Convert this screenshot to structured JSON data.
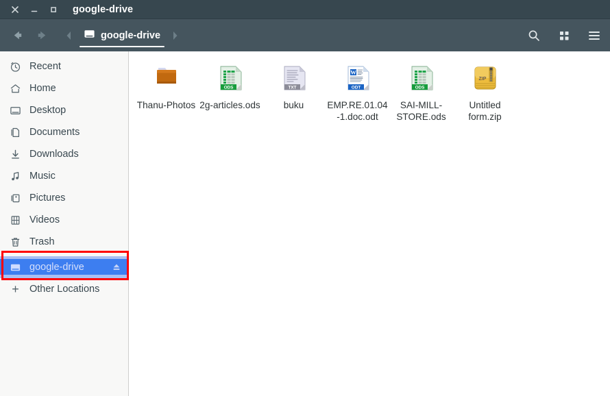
{
  "window": {
    "title": "google-drive",
    "controls": [
      {
        "name": "close",
        "glyph": "close-icon"
      },
      {
        "name": "minimize",
        "glyph": "minimize-icon"
      },
      {
        "name": "maximize",
        "glyph": "maximize-icon"
      }
    ]
  },
  "toolbar": {
    "back_label": "Back",
    "forward_label": "Forward",
    "prev_crumb_label": "",
    "next_crumb_label": "",
    "breadcrumb": {
      "label": "google-drive",
      "icon": "drive-icon"
    },
    "search_label": "Search",
    "view_grid_label": "View options",
    "menu_label": "Main menu"
  },
  "sidebar": {
    "items": [
      {
        "label": "Recent",
        "icon": "clock-icon",
        "selected": false
      },
      {
        "label": "Home",
        "icon": "home-icon",
        "selected": false
      },
      {
        "label": "Desktop",
        "icon": "desktop-icon",
        "selected": false
      },
      {
        "label": "Documents",
        "icon": "documents-icon",
        "selected": false
      },
      {
        "label": "Downloads",
        "icon": "downloads-icon",
        "selected": false
      },
      {
        "label": "Music",
        "icon": "music-icon",
        "selected": false
      },
      {
        "label": "Pictures",
        "icon": "pictures-icon",
        "selected": false
      },
      {
        "label": "Videos",
        "icon": "videos-icon",
        "selected": false
      },
      {
        "label": "Trash",
        "icon": "trash-icon",
        "selected": false
      },
      {
        "label": "google-drive",
        "icon": "drive-icon",
        "selected": true,
        "eject": true
      }
    ],
    "other_locations": {
      "label": "Other Locations",
      "icon": "plus-icon"
    }
  },
  "annotation": {
    "color": "#ff0000",
    "target": "google-drive"
  },
  "files": [
    {
      "name": "Thanu-Photos",
      "type": "folder",
      "icon": "folder-icon"
    },
    {
      "name": "2g-articles.ods",
      "type": "ods",
      "icon": "ods-file-icon"
    },
    {
      "name": "buku",
      "type": "txt",
      "icon": "txt-file-icon"
    },
    {
      "name": "EMP.RE.01.04-1.doc.odt",
      "type": "odt",
      "icon": "odt-file-icon"
    },
    {
      "name": "SAI-MILL-STORE.ods",
      "type": "ods",
      "icon": "ods-file-icon"
    },
    {
      "name": "Untitled form.zip",
      "type": "zip",
      "icon": "zip-file-icon"
    }
  ],
  "colors": {
    "titlebar": "#37474f",
    "toolbar": "#45555e",
    "sidebar": "#f8f8f7",
    "selection": "#3d7ef0",
    "annotation": "#ff0000",
    "pane": "#ffffff",
    "folder": "#c16a15",
    "ods_green": "#179c3c",
    "odt_blue": "#1b64c4",
    "zip_gold": "#edbc3d"
  }
}
